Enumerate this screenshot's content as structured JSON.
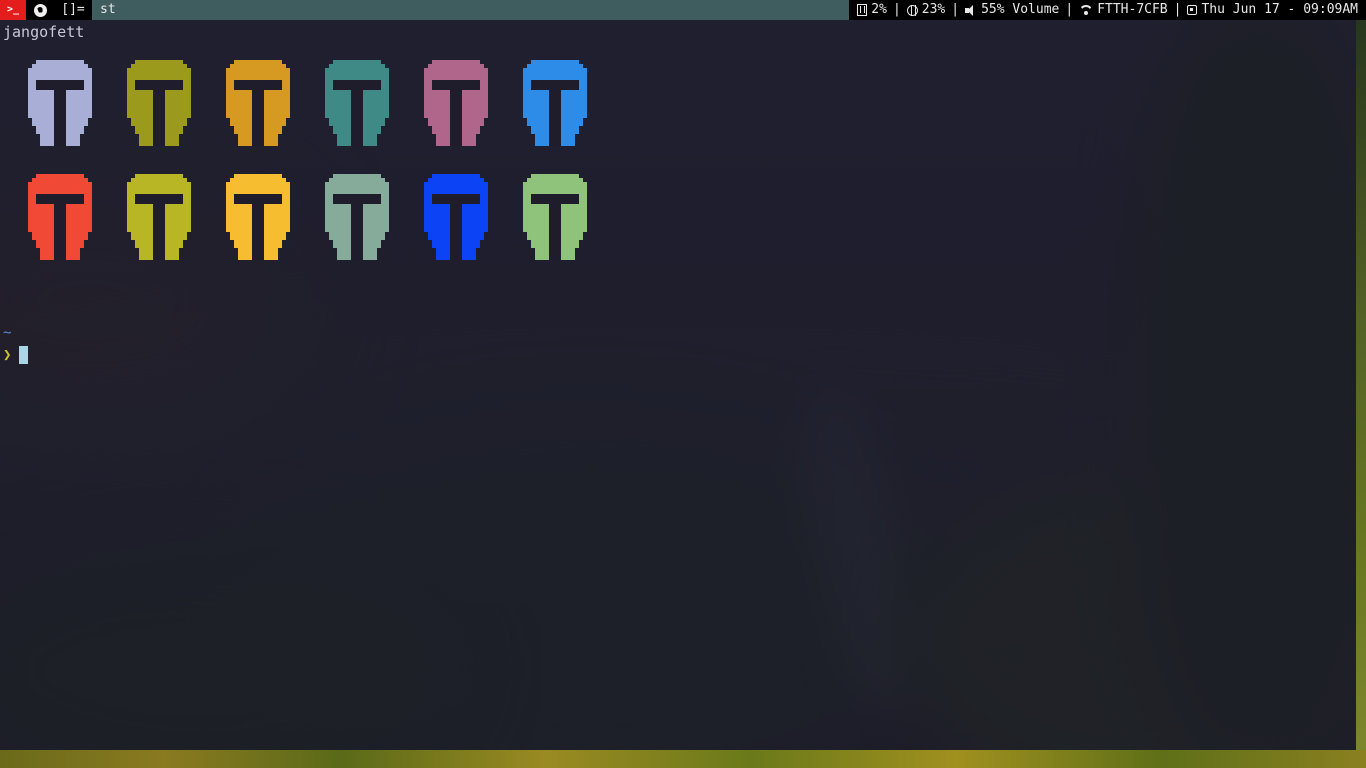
{
  "colors": {
    "launcher_bg": "#e31c1c",
    "title_bg": "#3f5c5e",
    "prompt_dir": "#5b8bd6",
    "prompt_arrow": "#d4c42b",
    "cursor": "#a9d5e6"
  },
  "topbar": {
    "launcher_icon": ">_",
    "tag_icon": "firefox-icon",
    "layout_symbol": "[]=",
    "window_title": "st",
    "status": {
      "memory": "2%",
      "cpu": "23%",
      "volume": "55% Volume",
      "wifi": "FTTH-7CFB",
      "datetime": "Thu Jun 17 - 09:09AM",
      "separator": "|"
    }
  },
  "terminal": {
    "hostname": "jangofett",
    "helmet_colors": [
      "#a9aed6",
      "#9c9a1c",
      "#d69a22",
      "#3f8a87",
      "#b0658a",
      "#2d8ce8",
      "#f04a37",
      "#b8b625",
      "#f6bd30",
      "#86ab9a",
      "#0b43f5",
      "#8fc27a"
    ],
    "prompt_dir": "~",
    "prompt_symbol": "❯"
  }
}
